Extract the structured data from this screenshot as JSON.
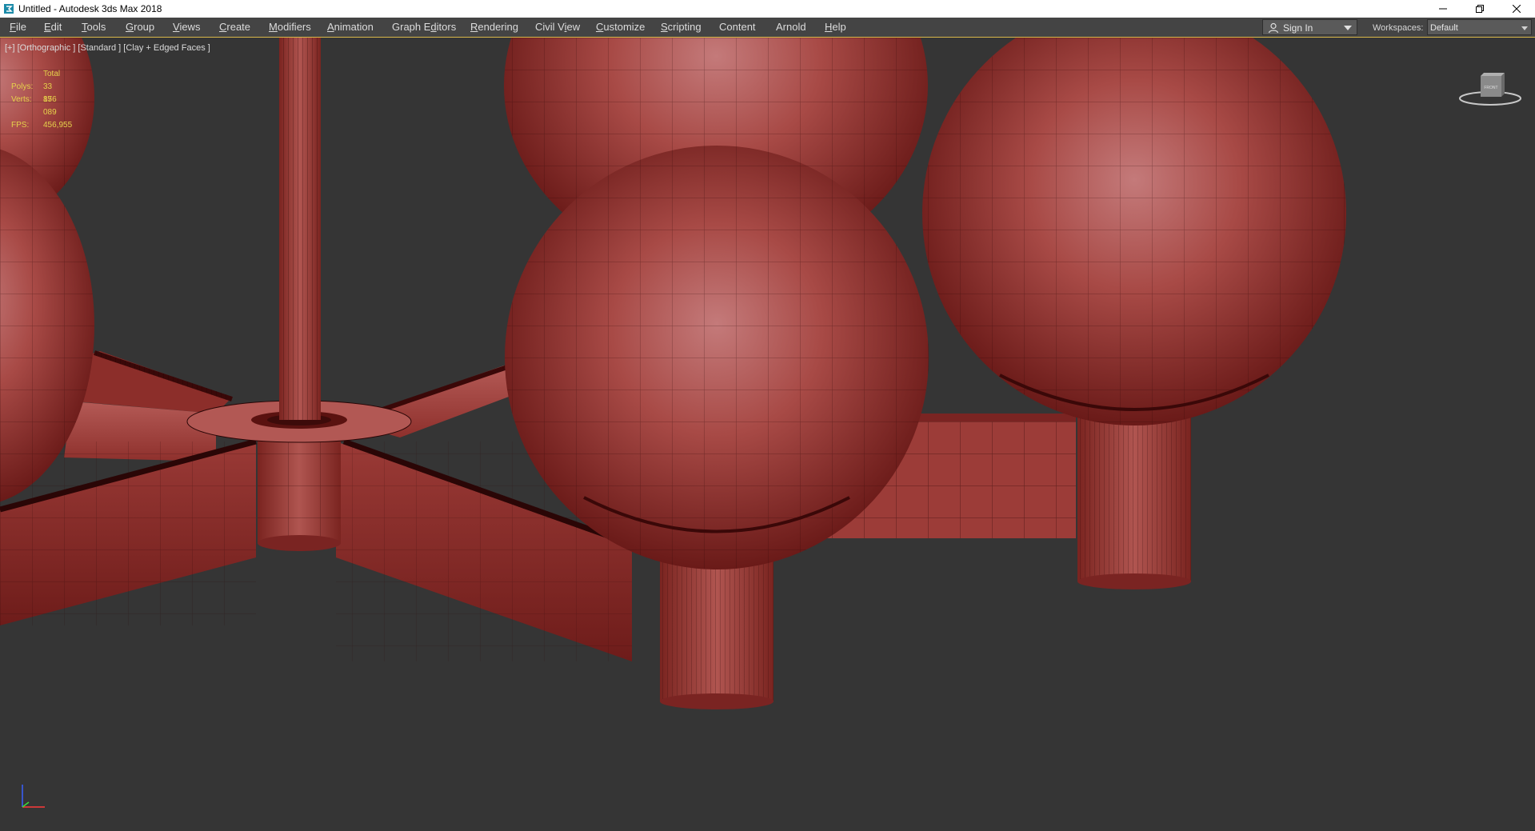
{
  "window": {
    "title": "Untitled - Autodesk 3ds Max 2018",
    "app_icon": "3ds-max-icon",
    "controls": [
      "minimize-icon",
      "restore-icon",
      "close-icon"
    ]
  },
  "menu": [
    {
      "label": "File",
      "mn": "F",
      "rest": "ile"
    },
    {
      "label": "Edit",
      "mn": "E",
      "rest": "dit"
    },
    {
      "label": "Tools",
      "mn": "T",
      "rest": "ools"
    },
    {
      "label": "Group",
      "mn": "G",
      "rest": "roup"
    },
    {
      "label": "Views",
      "mn": "V",
      "rest": "iews"
    },
    {
      "label": "Create",
      "mn": "C",
      "rest": "reate"
    },
    {
      "label": "Modifiers",
      "mn": "M",
      "rest": "odifiers"
    },
    {
      "label": "Animation",
      "mn": "A",
      "rest": "nimation"
    },
    {
      "label": "Graph Editors",
      "pre": "Graph E",
      "mn": "d",
      "rest": "itors"
    },
    {
      "label": "Rendering",
      "mn": "R",
      "rest": "endering"
    },
    {
      "label": "Civil View",
      "pre": "Civil V",
      "mn": "i",
      "rest": "ew"
    },
    {
      "label": "Customize",
      "mn": "C",
      "rest": "ustomize"
    },
    {
      "label": "Scripting",
      "mn": "S",
      "rest": "cripting"
    },
    {
      "label": "Content",
      "pre": "Content"
    },
    {
      "label": "Arnold",
      "pre": "Arnold"
    },
    {
      "label": "Help",
      "mn": "H",
      "rest": "elp"
    }
  ],
  "signin": {
    "label": "Sign In",
    "icon": "user-icon"
  },
  "workspaces": {
    "label": "Workspaces:",
    "value": "Default"
  },
  "viewport": {
    "label": "[+] [Orthographic ] [Standard ] [Clay + Edged Faces ]",
    "stats": {
      "total_label": "Total",
      "polys_label": "Polys:",
      "polys_value": "33 856",
      "verts_label": "Verts:",
      "verts_value": "17 089",
      "fps_label": "FPS:",
      "fps_value": "456,955"
    },
    "viewcube_face": "FRONT",
    "colors": {
      "background": "#353535",
      "clay_light": "#c06a6a",
      "clay_mid": "#a03a36",
      "clay_dark": "#6e1a18",
      "wire": "#2a0606",
      "stats_text": "#e6d24b"
    }
  }
}
